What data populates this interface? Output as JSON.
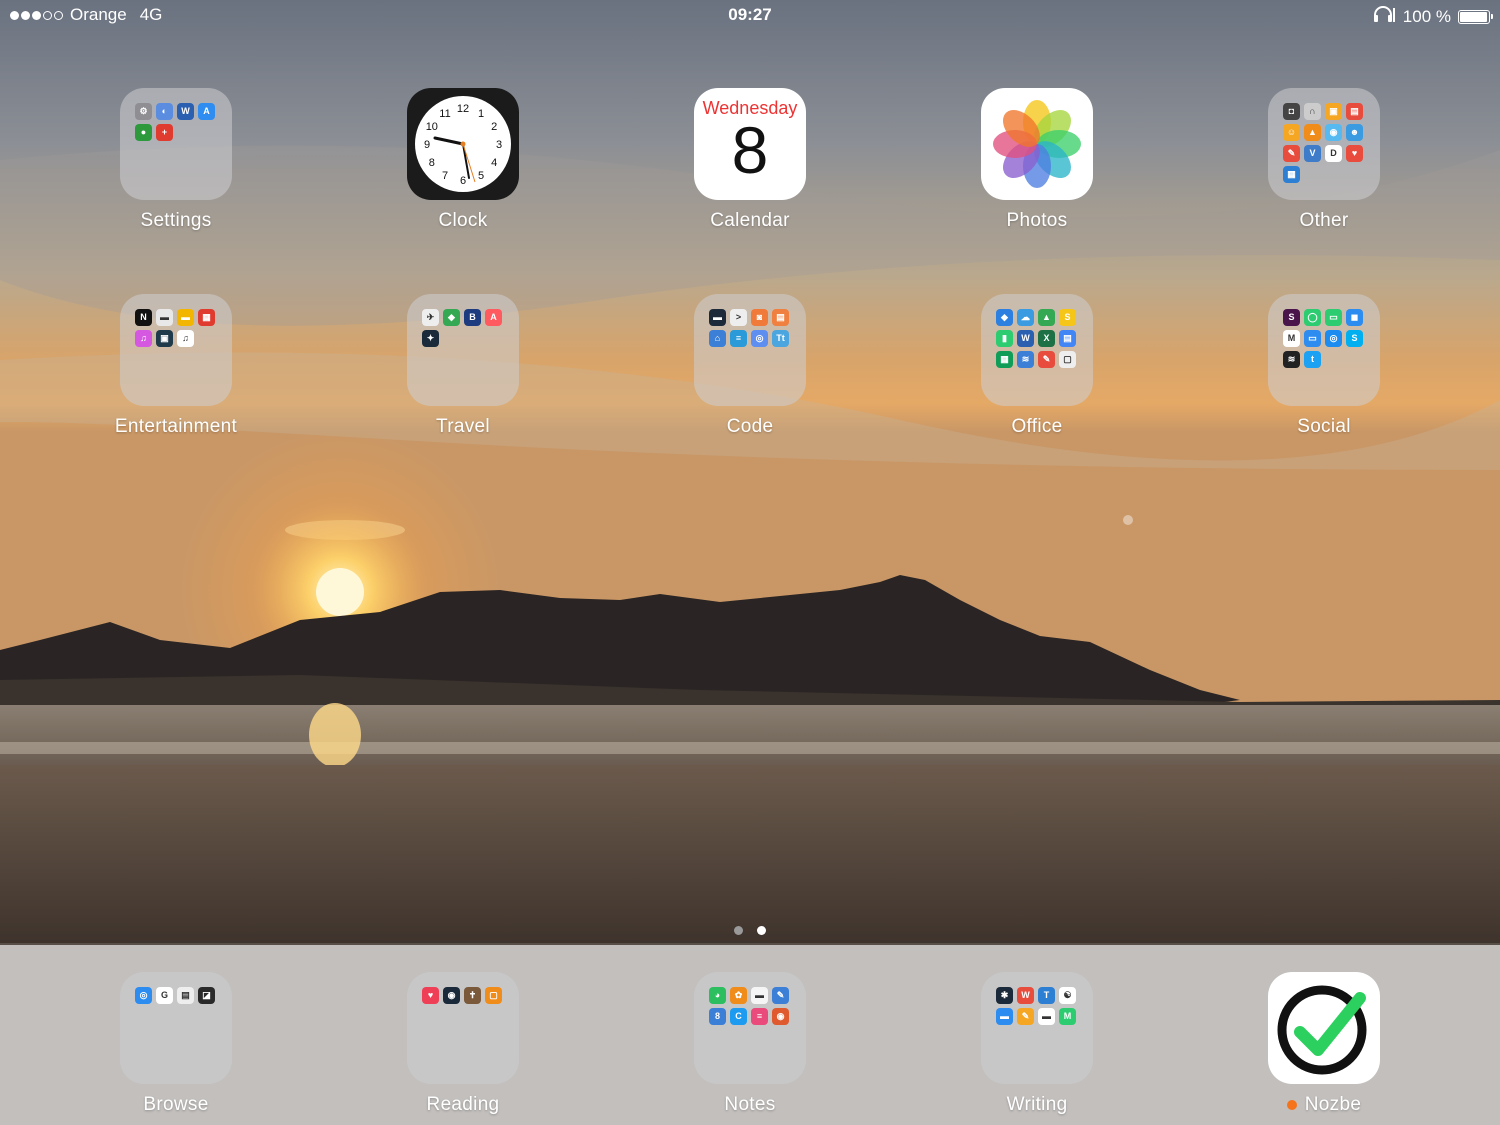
{
  "status_bar": {
    "carrier": "Orange",
    "network": "4G",
    "time": "09:27",
    "battery": "100 %",
    "signal_bars": 3,
    "signal_total": 5,
    "battery_level": 1.0
  },
  "page_indicator": {
    "total": 2,
    "current": 2
  },
  "home_apps": [
    {
      "label": "Settings",
      "kind": "folder",
      "minis": [
        {
          "color": "#8e8e93",
          "g": "⚙"
        },
        {
          "color": "#5a8de0",
          "g": "◐"
        },
        {
          "color": "#2b5fb0",
          "g": "W"
        },
        {
          "color": "#2f8cf0",
          "g": "A"
        },
        {
          "color": "#2c9a3c",
          "g": "●"
        },
        {
          "color": "#e03b2f",
          "g": "+"
        }
      ]
    },
    {
      "label": "Clock",
      "kind": "clock"
    },
    {
      "label": "Calendar",
      "kind": "calendar",
      "day_name": "Wednesday",
      "day_number": "8"
    },
    {
      "label": "Photos",
      "kind": "photos"
    },
    {
      "label": "Other",
      "kind": "folder",
      "minis": [
        {
          "color": "#444",
          "g": "◘"
        },
        {
          "color": "#ccc",
          "g": "∩"
        },
        {
          "color": "#f5a623",
          "g": "▣"
        },
        {
          "color": "#e74c3c",
          "g": "▤"
        },
        {
          "color": "#f5a623",
          "g": "☺"
        },
        {
          "color": "#f08c1a",
          "g": "▲"
        },
        {
          "color": "#56b9f0",
          "g": "◉"
        },
        {
          "color": "#3a9be0",
          "g": "☻"
        },
        {
          "color": "#e74c3c",
          "g": "✎"
        },
        {
          "color": "#3e7cc9",
          "g": "V"
        },
        {
          "color": "#fff",
          "g": "D"
        },
        {
          "color": "#e94b3c",
          "g": "♥"
        },
        {
          "color": "#2d7fd3",
          "g": "▦"
        }
      ]
    },
    {
      "label": "Entertainment",
      "kind": "folder",
      "minis": [
        {
          "color": "#111",
          "g": "N"
        },
        {
          "color": "#e8e8e8",
          "g": "▬"
        },
        {
          "color": "#f2b600",
          "g": "▬"
        },
        {
          "color": "#e03b2f",
          "g": "▦"
        },
        {
          "color": "#d558e0",
          "g": "♫"
        },
        {
          "color": "#1f3a4a",
          "g": "▣"
        },
        {
          "color": "#fff",
          "g": "♫"
        }
      ]
    },
    {
      "label": "Travel",
      "kind": "folder",
      "minis": [
        {
          "color": "#eee",
          "g": "✈"
        },
        {
          "color": "#34a853",
          "g": "◆"
        },
        {
          "color": "#1d3c80",
          "g": "B"
        },
        {
          "color": "#ff5a5f",
          "g": "A"
        },
        {
          "color": "#1a2a3a",
          "g": "✦"
        }
      ]
    },
    {
      "label": "Code",
      "kind": "folder",
      "minis": [
        {
          "color": "#1d2a3a",
          "g": "▬"
        },
        {
          "color": "#eee",
          "g": ">"
        },
        {
          "color": "#f07a3a",
          "g": "◙"
        },
        {
          "color": "#f08040",
          "g": "▤"
        },
        {
          "color": "#3b7fd6",
          "g": "⌂"
        },
        {
          "color": "#2a9bd8",
          "g": "≡"
        },
        {
          "color": "#5e8ef0",
          "g": "◎"
        },
        {
          "color": "#4ba6e0",
          "g": "Tt"
        }
      ]
    },
    {
      "label": "Office",
      "kind": "folder",
      "minis": [
        {
          "color": "#2d7fe0",
          "g": "◆"
        },
        {
          "color": "#3a9be0",
          "g": "☁"
        },
        {
          "color": "#34a853",
          "g": "▲"
        },
        {
          "color": "#f5c518",
          "g": "S"
        },
        {
          "color": "#2ecc71",
          "g": "▮"
        },
        {
          "color": "#2b5fb0",
          "g": "W"
        },
        {
          "color": "#1e7145",
          "g": "X"
        },
        {
          "color": "#4285f4",
          "g": "▤"
        },
        {
          "color": "#0f9d58",
          "g": "▦"
        },
        {
          "color": "#3b7fd6",
          "g": "≋"
        },
        {
          "color": "#e74c3c",
          "g": "✎"
        },
        {
          "color": "#eee",
          "g": "▢"
        }
      ]
    },
    {
      "label": "Social",
      "kind": "folder",
      "minis": [
        {
          "color": "#4a154b",
          "g": "S"
        },
        {
          "color": "#2ecc71",
          "g": "◯"
        },
        {
          "color": "#2ecc71",
          "g": "▭"
        },
        {
          "color": "#2d8cf0",
          "g": "◼"
        },
        {
          "color": "#fff",
          "g": "M"
        },
        {
          "color": "#2d8cf0",
          "g": "▭"
        },
        {
          "color": "#1d8cf0",
          "g": "◎"
        },
        {
          "color": "#00aff0",
          "g": "S"
        },
        {
          "color": "#222",
          "g": "≋"
        },
        {
          "color": "#1da1f2",
          "g": "t"
        }
      ]
    }
  ],
  "dock_apps": [
    {
      "label": "Browse",
      "kind": "folder",
      "minis": [
        {
          "color": "#2d8cf0",
          "g": "◎"
        },
        {
          "color": "#fff",
          "g": "G"
        },
        {
          "color": "#eee",
          "g": "▤"
        },
        {
          "color": "#2a2a2a",
          "g": "◪"
        }
      ]
    },
    {
      "label": "Reading",
      "kind": "folder",
      "minis": [
        {
          "color": "#ef3f56",
          "g": "♥"
        },
        {
          "color": "#1a2a3a",
          "g": "◉"
        },
        {
          "color": "#7a5a3a",
          "g": "✝"
        },
        {
          "color": "#f08c1a",
          "g": "▢"
        }
      ]
    },
    {
      "label": "Notes",
      "kind": "folder",
      "minis": [
        {
          "color": "#2dbe60",
          "g": "◕"
        },
        {
          "color": "#f08c1a",
          "g": "✿"
        },
        {
          "color": "#f5f5f5",
          "g": "▬"
        },
        {
          "color": "#3b7fd6",
          "g": "✎"
        },
        {
          "color": "#3b7fd6",
          "g": "8"
        },
        {
          "color": "#1d9bf0",
          "g": "C"
        },
        {
          "color": "#e94b7c",
          "g": "≡"
        },
        {
          "color": "#e05a2f",
          "g": "◉"
        }
      ]
    },
    {
      "label": "Writing",
      "kind": "folder",
      "minis": [
        {
          "color": "#1a2a3a",
          "g": "✱"
        },
        {
          "color": "#e74c3c",
          "g": "W"
        },
        {
          "color": "#2d7fd3",
          "g": "T"
        },
        {
          "color": "#fff",
          "g": "☯"
        },
        {
          "color": "#2d8cf0",
          "g": "▬"
        },
        {
          "color": "#f5a623",
          "g": "✎"
        },
        {
          "color": "#fff",
          "g": "▬"
        },
        {
          "color": "#2ecc71",
          "g": "M"
        }
      ]
    },
    {
      "label": "Nozbe",
      "kind": "nozbe",
      "badge_color": "#f5731a"
    }
  ],
  "colors": {
    "dot_active": "#ffffff",
    "dot_inactive": "#9a9a9a",
    "nozbe_check": "#2bd05e"
  }
}
